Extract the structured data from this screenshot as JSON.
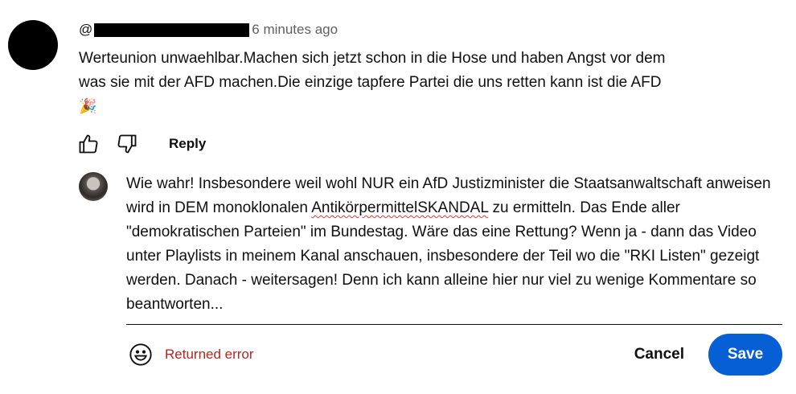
{
  "comment": {
    "author_prefix": "@",
    "time": "6 minutes ago",
    "text": "Werteunion unwaehlbar.Machen sich jetzt schon in die Hose und haben Angst vor dem\nwas sie mit der AFD machen.Die einzige tapfere Partei die uns retten kann ist die AFD",
    "emoji": "🎉",
    "actions": {
      "like_icon": "thumbs-up-icon",
      "dislike_icon": "thumbs-down-icon",
      "reply_label": "Reply"
    }
  },
  "reply_editor": {
    "text_before": "Wie wahr! Insbesondere weil wohl NUR ein AfD Justizminister die Staatsanwaltschaft anweisen wird in DEM monoklonalen ",
    "misspelled_word": "AntikörpermittelSKANDAL",
    "text_after": " zu ermitteln. Das Ende aller \"demokratischen Parteien\" im Bundestag. Wäre das eine Rettung? Wenn ja - dann das Video unter Playlists in meinem Kanal anschauen, insbesondere der Teil wo die \"RKI Listen\" gezeigt werden. Danach - weitersagen! Denn ich kann alleine hier nur viel zu wenige Kommentare so beantworten...",
    "emoji_icon": "smiley-face-icon",
    "error_text": "Returned error",
    "cancel_label": "Cancel",
    "save_label": "Save"
  },
  "colors": {
    "save_button": "#065fd4",
    "error": "#b3261e",
    "secondary_text": "#606060",
    "spellcheck": "#e53935"
  }
}
